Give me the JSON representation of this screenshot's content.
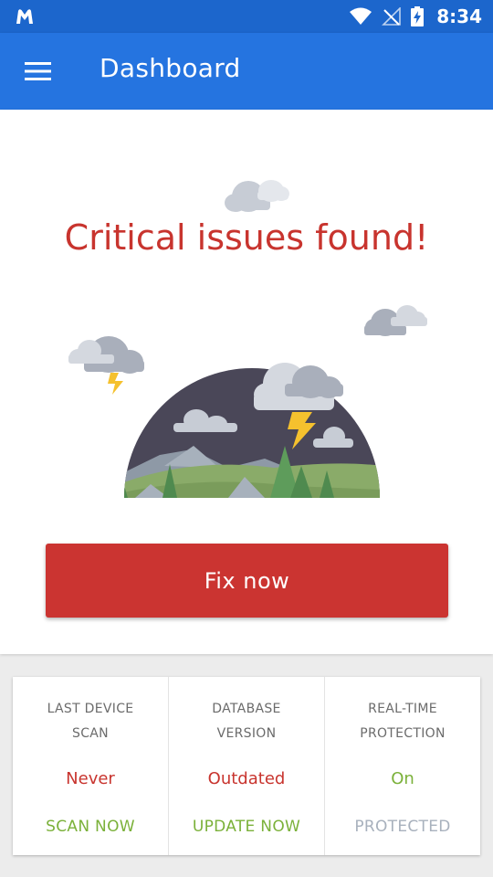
{
  "status_bar": {
    "time": "8:34",
    "icons": [
      "malwarebytes-logo-icon",
      "wifi-icon",
      "no-signal-icon",
      "battery-charging-icon"
    ]
  },
  "app_bar": {
    "title": "Dashboard",
    "menu_icon": "hamburger-menu-icon"
  },
  "hero": {
    "headline": "Critical issues found!",
    "fix_button_label": "Fix now"
  },
  "colors": {
    "status_bar": "#1c66cc",
    "app_bar": "#2574e0",
    "critical": "#c8342e",
    "button": "#cb3431",
    "ok_green": "#7bb13a",
    "muted": "#a8b1bd"
  },
  "status_cards": [
    {
      "title": "LAST DEVICE SCAN",
      "value": "Never",
      "value_color": "#c8342e",
      "action": "SCAN NOW",
      "action_color": "#7bb13a"
    },
    {
      "title": "DATABASE VERSION",
      "value": "Outdated",
      "value_color": "#c8342e",
      "action": "UPDATE NOW",
      "action_color": "#7bb13a"
    },
    {
      "title": "REAL-TIME PROTECTION",
      "value": "On",
      "value_color": "#7bb13a",
      "action": "PROTECTED",
      "action_color": "#a8b1bd"
    }
  ]
}
